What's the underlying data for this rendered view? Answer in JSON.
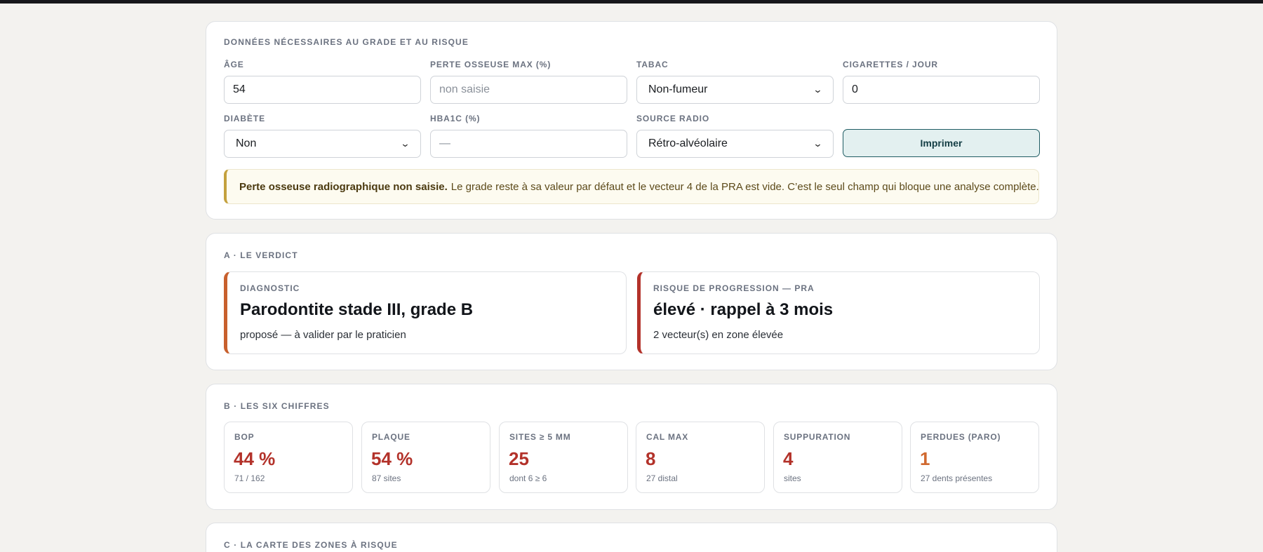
{
  "inputs_section": {
    "title": "DONNÉES NÉCESSAIRES AU GRADE ET AU RISQUE",
    "age": {
      "label": "ÂGE",
      "value": "54"
    },
    "bone_loss": {
      "label": "PERTE OSSEUSE MAX (%)",
      "placeholder": "non saisie"
    },
    "tobacco": {
      "label": "TABAC",
      "value": "Non-fumeur"
    },
    "cigarettes": {
      "label": "CIGARETTES / JOUR",
      "value": "0"
    },
    "diabetes": {
      "label": "DIABÈTE",
      "value": "Non"
    },
    "hba1c": {
      "label": "HBA1C (%)",
      "placeholder": "—"
    },
    "radio_source": {
      "label": "SOURCE RADIO",
      "value": "Rétro-alvéolaire"
    },
    "print_label": "Imprimer",
    "alert": {
      "bold": "Perte osseuse radiographique non saisie.",
      "text": "Le grade reste à sa valeur par défaut et le vecteur 4 de la PRA est vide. C’est le seul champ qui bloque une analyse complète."
    }
  },
  "verdict_section": {
    "title": "A · LE VERDICT",
    "diagnostic": {
      "label": "DIAGNOSTIC",
      "value": "Parodontite stade III, grade B",
      "sub": "proposé — à valider par le praticien"
    },
    "risk": {
      "label": "RISQUE DE PROGRESSION — PRA",
      "value": "élevé · rappel à 3 mois",
      "sub": "2 vecteur(s) en zone élevée"
    }
  },
  "numbers_section": {
    "title": "B · LES SIX CHIFFRES",
    "stats": [
      {
        "label": "BOP",
        "value": "44 %",
        "sub": "71 / 162",
        "color": "#b3322a"
      },
      {
        "label": "PLAQUE",
        "value": "54 %",
        "sub": "87 sites",
        "color": "#b3322a"
      },
      {
        "label": "SITES ≥ 5 MM",
        "value": "25",
        "sub": "dont 6 ≥ 6",
        "color": "#b3322a"
      },
      {
        "label": "CAL MAX",
        "value": "8",
        "sub": "27 distal",
        "color": "#b3322a"
      },
      {
        "label": "SUPPURATION",
        "value": "4",
        "sub": "sites",
        "color": "#b3322a"
      },
      {
        "label": "PERDUES (PARO)",
        "value": "1",
        "sub": "27 dents présentes",
        "color": "#d0692f"
      }
    ]
  },
  "map_section": {
    "title": "C · LA CARTE DES ZONES À RISQUE"
  }
}
